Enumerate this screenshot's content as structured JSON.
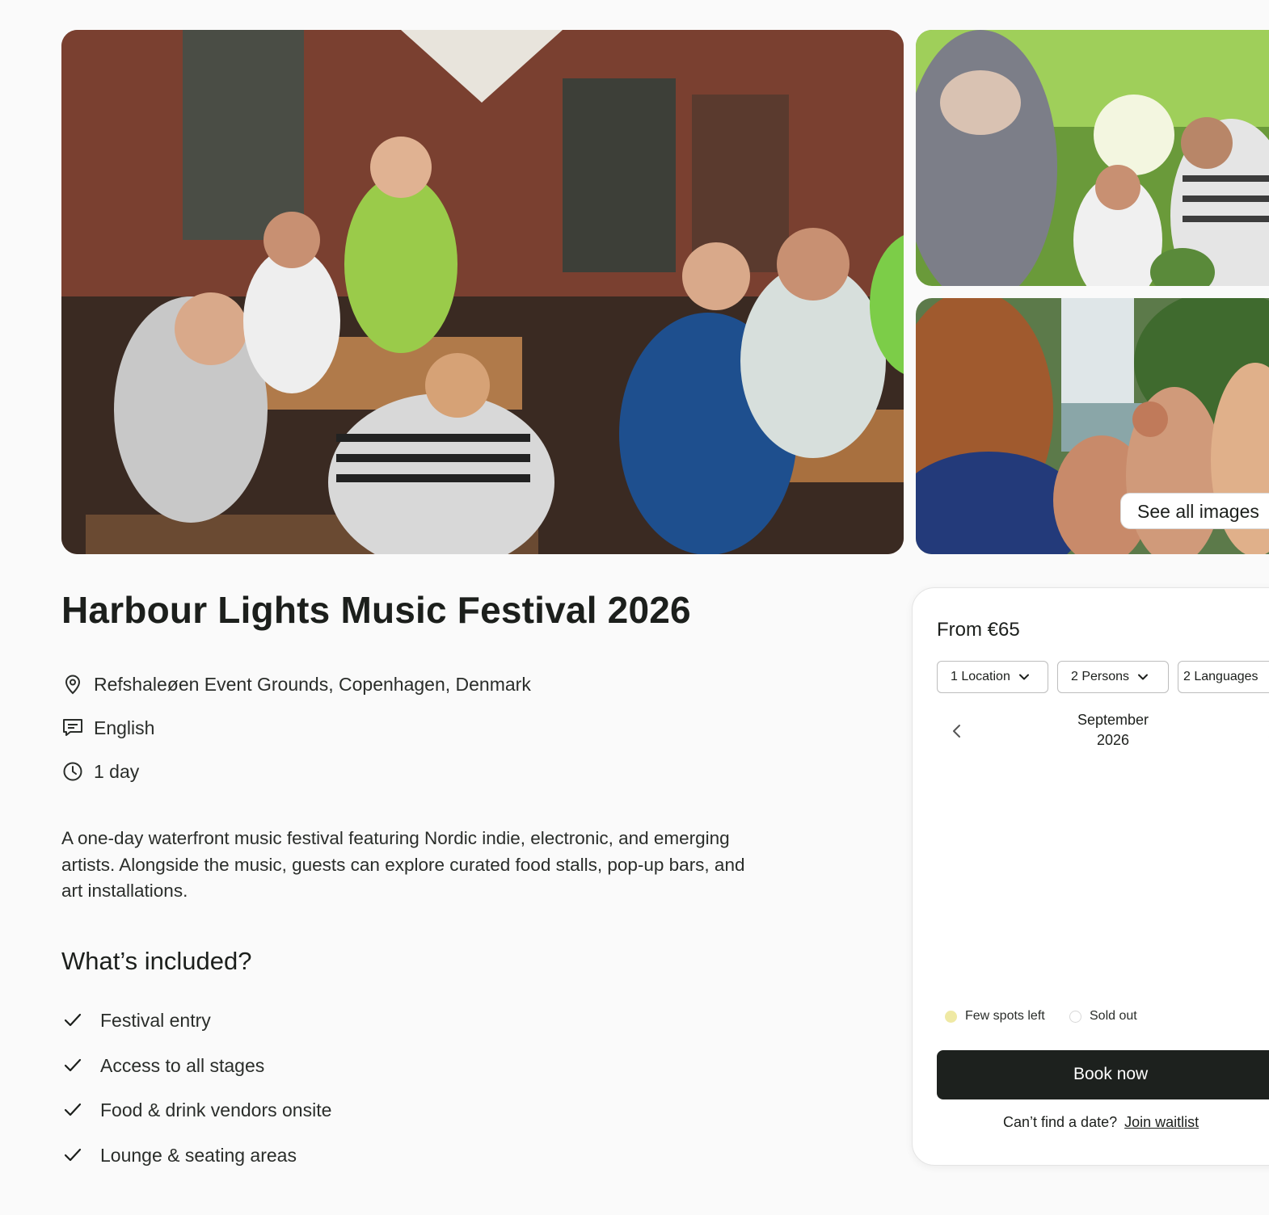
{
  "gallery": {
    "see_all_label": "See all images"
  },
  "event": {
    "title": "Harbour Lights Music Festival 2026",
    "location": "Refshaleøen Event Grounds, Copenhagen, Denmark",
    "language": "English",
    "duration": "1 day",
    "description": "A one-day waterfront music festival featuring Nordic indie, electronic, and emerging artists. Alongside the music, guests can explore curated food stalls, pop-up bars, and art installations."
  },
  "included": {
    "heading": "What’s included?",
    "items": [
      "Festival entry",
      "Access to all stages",
      "Food & drink vendors onsite",
      "Lounge & seating areas"
    ]
  },
  "booking": {
    "price": "From €65",
    "filters": {
      "location": "1 Location",
      "persons": "2 Persons",
      "languages": "2 Languages"
    },
    "calendar": {
      "month": "September",
      "year": "2026"
    },
    "legend": {
      "few_spots": "Few spots left",
      "sold_out": "Sold out"
    },
    "book_label": "Book now",
    "waitlist_prompt": "Can’t find a date?",
    "waitlist_link": "Join waitlist"
  },
  "colors": {
    "page_bg": "#fafafa",
    "primary_button": "#1d211e",
    "few_spots_dot": "#efe9a4"
  }
}
